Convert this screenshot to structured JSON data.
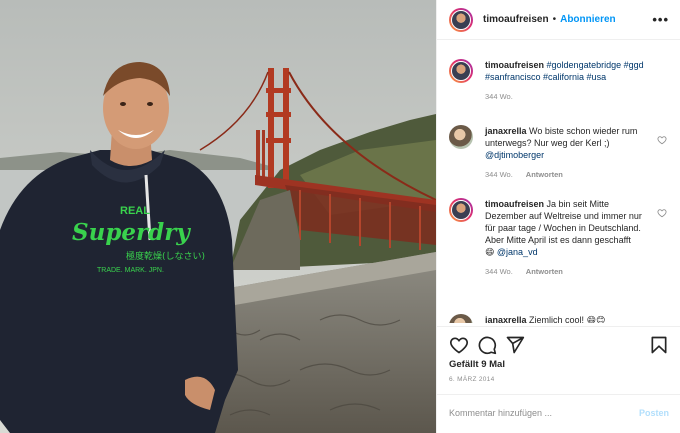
{
  "post": {
    "username": "timoaufreisen",
    "separator": "•",
    "follow_label": "Abonnieren",
    "more_label": "•••"
  },
  "caption": {
    "username": "timoaufreisen",
    "hashtags": "#goldengatebridge #ggd #sanfrancisco #california #usa",
    "age": "344 Wo."
  },
  "comments": [
    {
      "username": "janaxrella",
      "text": "Wo biste schon wieder rum unterwegs? Nur weg der Kerl ;) ",
      "mention": "@djtimoberger",
      "age": "344 Wo.",
      "reply_label": "Antworten"
    },
    {
      "username": "timoaufreisen",
      "text": "Ja bin seit Mitte Dezember auf Weltreise und immer nur für paar tage / Wochen in Deutschland. Aber Mitte April ist es dann geschafft ",
      "emoji": "😄",
      "mention": "@jana_vd",
      "age": "344 Wo.",
      "reply_label": "Antworten"
    },
    {
      "username": "janaxrella",
      "text": "Ziemlich cool! 😄😊"
    }
  ],
  "stats": {
    "likes": "Gefällt 9 Mal",
    "date": "6. MÄRZ 2014"
  },
  "add_comment": {
    "placeholder": "Kommentar hinzufügen ...",
    "post_label": "Posten"
  },
  "photo": {
    "shirt_text_line1": "REAL",
    "shirt_text_line2": "Superdry",
    "shirt_text_line3": "極度乾燥(しなさい)",
    "shirt_text_line4": "TRADE. MARK. JPN."
  },
  "colors": {
    "accent": "#0095f6",
    "post_disabled": "#b2dffc",
    "meta": "#8e8e8e",
    "hashtag": "#00376b",
    "hoodie": "#1f2432",
    "shirt_print": "#39d24d",
    "bridge": "#b23a22"
  }
}
